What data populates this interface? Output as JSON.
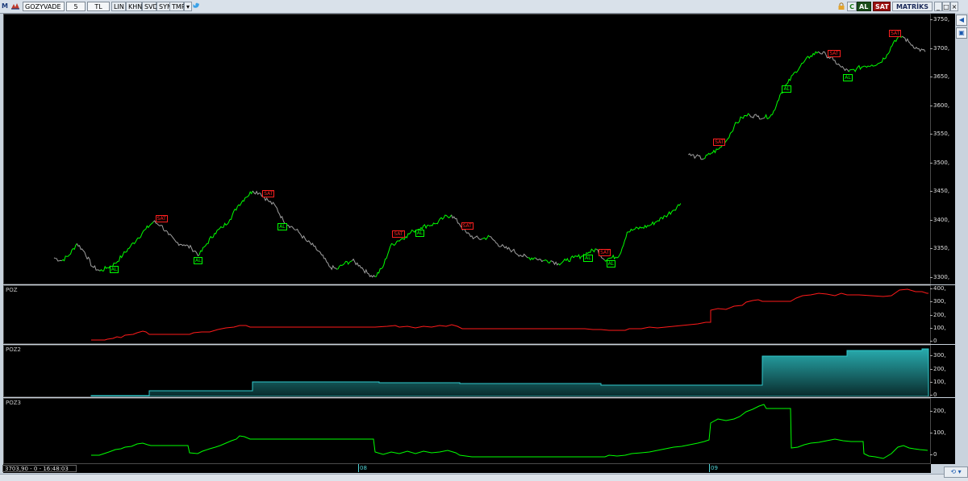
{
  "toolbar": {
    "logo": "M",
    "symbol": "GOZYVADE",
    "period": "5",
    "currency": "TL",
    "buttons": [
      "LIN",
      "KHN",
      "SVD",
      "SYM",
      "TMP"
    ],
    "buy_label": "AL",
    "sell_label": "SAT",
    "brand": "MATRİKS",
    "refresh_label": "C"
  },
  "price_axis": {
    "ticks": [
      "3750,",
      "3700,",
      "3650,",
      "3600,",
      "3550,",
      "3500,",
      "3450,",
      "3400,",
      "3350,",
      "3300,"
    ]
  },
  "signals": [
    {
      "type": "buy",
      "label": "AL"
    },
    {
      "type": "sell",
      "label": "SAT"
    },
    {
      "type": "buy",
      "label": "AL"
    },
    {
      "type": "sell",
      "label": "SAT"
    },
    {
      "type": "buy",
      "label": "AL"
    },
    {
      "type": "sell",
      "label": "SAT"
    },
    {
      "type": "buy",
      "label": "AL"
    },
    {
      "type": "sell",
      "label": "SAT"
    },
    {
      "type": "buy",
      "label": "AL"
    },
    {
      "type": "sell",
      "label": "SAT"
    },
    {
      "type": "buy",
      "label": "AL"
    },
    {
      "type": "sell",
      "label": "SAT"
    },
    {
      "type": "buy",
      "label": "AL"
    },
    {
      "type": "sell",
      "label": "SAT"
    },
    {
      "type": "buy",
      "label": "AL"
    },
    {
      "type": "sell",
      "label": "SAT"
    }
  ],
  "panes": {
    "poz": {
      "label": "POZ",
      "ticks": [
        "400,",
        "300,",
        "200,",
        "100,",
        "0"
      ],
      "color": "#ff1a1a"
    },
    "poz2": {
      "label": "POZ2",
      "ticks": [
        "300,",
        "200,",
        "100,",
        "0"
      ],
      "color": "#2fc9cc"
    },
    "poz3": {
      "label": "POZ3",
      "ticks": [
        "200,",
        "100,",
        "0"
      ],
      "color": "#00ff00"
    }
  },
  "status": {
    "readout": "3703,90 - 0 - 16:48:03",
    "dates": [
      "08",
      "09"
    ]
  },
  "colors": {
    "price_up": "#00ff00",
    "price_down": "#a0a0a0",
    "background": "#000000"
  },
  "chart_data": {
    "type": "line",
    "title": "GOZYVADE",
    "ylim": [
      3290,
      3760
    ],
    "series": [
      {
        "values": [
          3335,
          3330,
          3340,
          3360,
          3345,
          3320,
          3312,
          3318,
          3325,
          3340,
          3355,
          3370,
          3385,
          3398,
          3392,
          3375,
          3362,
          3358,
          3352,
          3340,
          3360,
          3378,
          3388,
          3402,
          3425,
          3440,
          3452,
          3448,
          3435,
          3425,
          3400,
          3390,
          3380,
          3365,
          3355,
          3340,
          3320,
          3315,
          3325,
          3330,
          3322,
          3308,
          3302,
          3318,
          3355,
          3365,
          3372,
          3382,
          3388,
          3392,
          3395,
          3405,
          3410,
          3395,
          3378,
          3370,
          3368,
          3372,
          3360,
          3352,
          3348,
          3340,
          3335,
          3335,
          3330,
          3330,
          3325,
          3330,
          3335,
          3338,
          3345,
          3350,
          3332,
          3335,
          3340,
          3380,
          3385,
          3388,
          3392,
          3400,
          3408,
          3418,
          3430,
          3515,
          3512,
          3508,
          3518,
          3525,
          3540,
          3565,
          3580,
          3585,
          3582,
          3580,
          3585,
          3620,
          3640,
          3660,
          3675,
          3688,
          3695,
          3690,
          3680,
          3668,
          3660,
          3665,
          3670,
          3672,
          3675,
          3690,
          3715,
          3722,
          3710,
          3700,
          3695
        ]
      }
    ]
  }
}
